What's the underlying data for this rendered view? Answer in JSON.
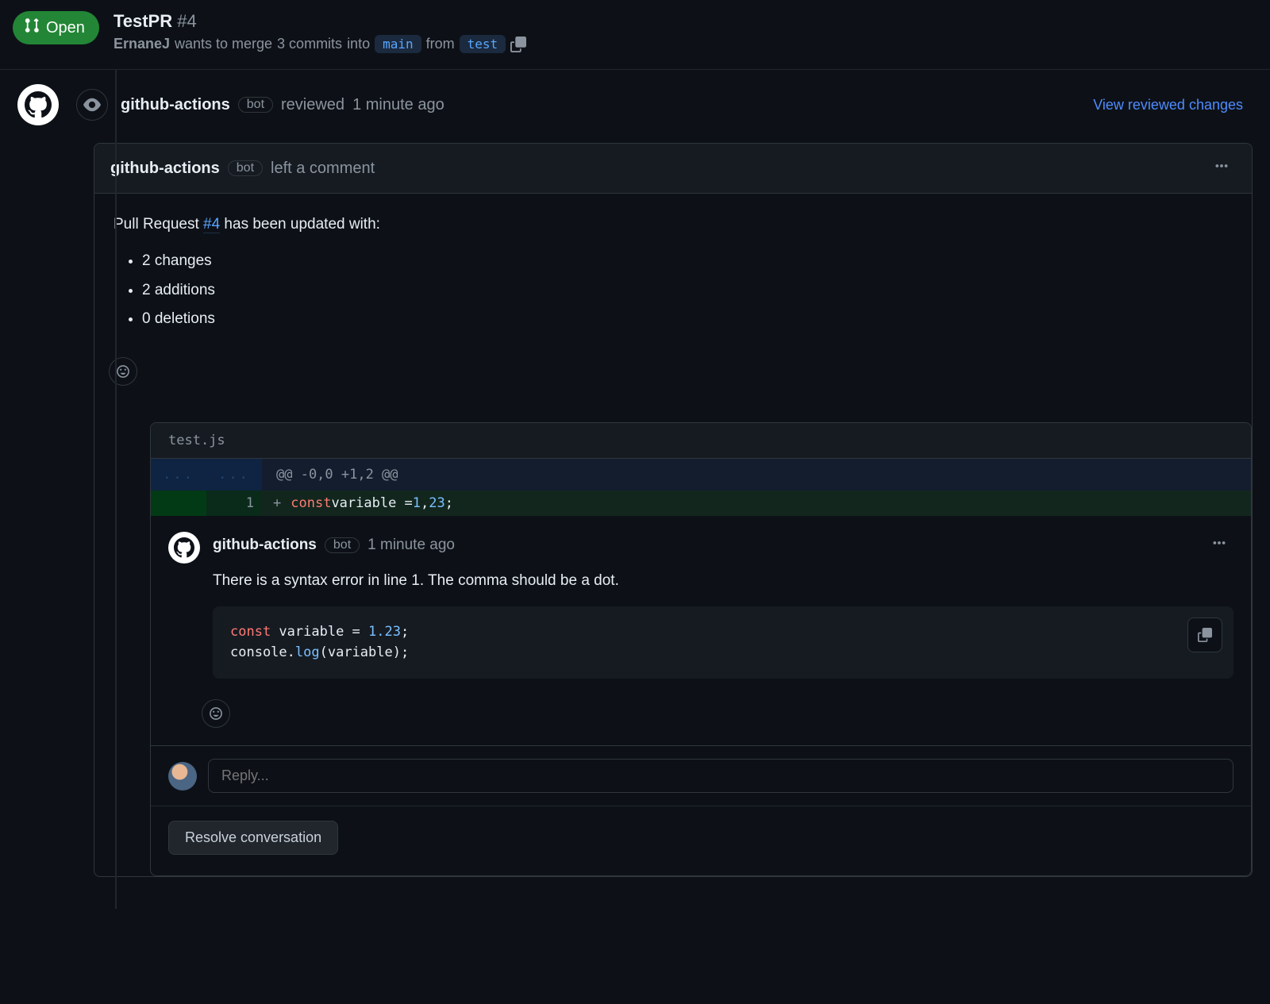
{
  "pr": {
    "state": "Open",
    "title": "TestPR",
    "number": "#4",
    "author": "ErnaneJ",
    "merge_text_a": "wants to merge",
    "commits": "3 commits",
    "merge_text_b": "into",
    "base_branch": "main",
    "from_text": "from",
    "head_branch": "test"
  },
  "review_event": {
    "actor": "github-actions",
    "bot_label": "bot",
    "action": "reviewed",
    "timestamp": "1 minute ago",
    "view_link": "View reviewed changes"
  },
  "comment": {
    "actor": "github-actions",
    "bot_label": "bot",
    "action": "left a comment",
    "body_prefix": "Pull Request ",
    "body_link": "#4",
    "body_suffix": " has been updated with:",
    "bullets": [
      "2 changes",
      "2 additions",
      "0 deletions"
    ]
  },
  "diff": {
    "filename": "test.js",
    "hunk": "@@ -0,0 +1,2 @@",
    "ellipsis": "...",
    "line_number": "1",
    "code_tokens": {
      "plus": "+",
      "const": "const",
      "variable_eq": " variable = ",
      "one": "1",
      "comma": ",",
      "twentythree": "23",
      "semi": ";"
    }
  },
  "inline_comment": {
    "actor": "github-actions",
    "bot_label": "bot",
    "timestamp": "1 minute ago",
    "text": "There is a syntax error in line 1. The comma should be a dot.",
    "code_lines": {
      "l1_const": "const",
      "l1_rest": " variable = ",
      "l1_num": "1.23",
      "l1_semi": ";",
      "l2_a": "console.",
      "l2_log": "log",
      "l2_rest": "(variable);"
    }
  },
  "reply": {
    "placeholder": "Reply..."
  },
  "resolve": {
    "label": "Resolve conversation"
  }
}
